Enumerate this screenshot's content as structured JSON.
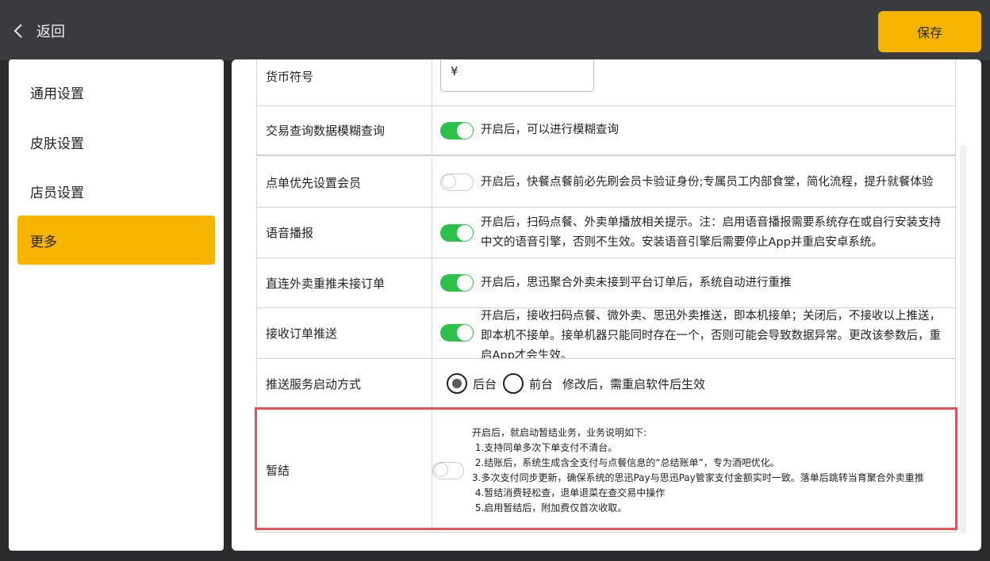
{
  "header": {
    "back_label": "返回",
    "save_label": "保存"
  },
  "sidebar": {
    "items": [
      {
        "label": "通用设置"
      },
      {
        "label": "皮肤设置"
      },
      {
        "label": "店员设置"
      },
      {
        "label": "更多",
        "active": true
      }
    ]
  },
  "settings": {
    "currency": {
      "label": "货币符号",
      "value": "¥"
    },
    "fuzzy_query": {
      "label": "交易查询数据模糊查询",
      "enabled": true,
      "desc": "开启后，可以进行模糊查询"
    },
    "member_first": {
      "label": "点单优先设置会员",
      "enabled": false,
      "desc": "开启后，快餐点餐前必先刷会员卡验证身份;专属员工内部食堂，简化流程，提升就餐体验"
    },
    "voice": {
      "label": "语音播报",
      "enabled": true,
      "desc": "开启后，扫码点餐、外卖单播放相关提示。注：启用语音播报需要系统存在或自行安装支持中文的语音引擎，否则不生效。安装语音引擎后需要停止App并重启安卓系统。"
    },
    "repush": {
      "label": "直连外卖重推未接订单",
      "enabled": true,
      "desc": "开启后，思迅聚合外卖未接到平台订单后，系统自动进行重推"
    },
    "receive_push": {
      "label": "接收订单推送",
      "enabled": true,
      "desc": "开启后，接收扫码点餐、微外卖、思迅外卖推送，即本机接单；关闭后，不接收以上推送，即本机不接单。接单机器只能同时存在一个，否则可能会导致数据异常。更改该参数后，重启App才会生效。"
    },
    "push_mode": {
      "label": "推送服务启动方式",
      "option_bg": "后台",
      "option_fg": "前台",
      "selected": "后台",
      "note": "修改后，需重启软件后生效"
    },
    "tab_settle": {
      "label": "暂结",
      "enabled": false,
      "lines": [
        "开启后，就启动暂结业务，业务说明如下:",
        " 1.支持同单多次下单支付不清台。",
        " 2.结账后，系统生成含全支付与点餐信息的“总结账单”，专为酒吧优化。",
        " 3.多次支付同步更新，确保系统的思迅Pay与思迅Pay管家支付金额实时一致。落单后跳转当育聚合外卖重推",
        " 4.暂结消费轻松查，退单退菜在查交易中操作",
        " 5.启用暂结后，附加费仅首次收取。"
      ]
    }
  },
  "colors": {
    "accent": "#f5b400",
    "toggle_on": "#2bc14a",
    "highlight": "#e8505a",
    "topbar": "#3a3b3e"
  }
}
